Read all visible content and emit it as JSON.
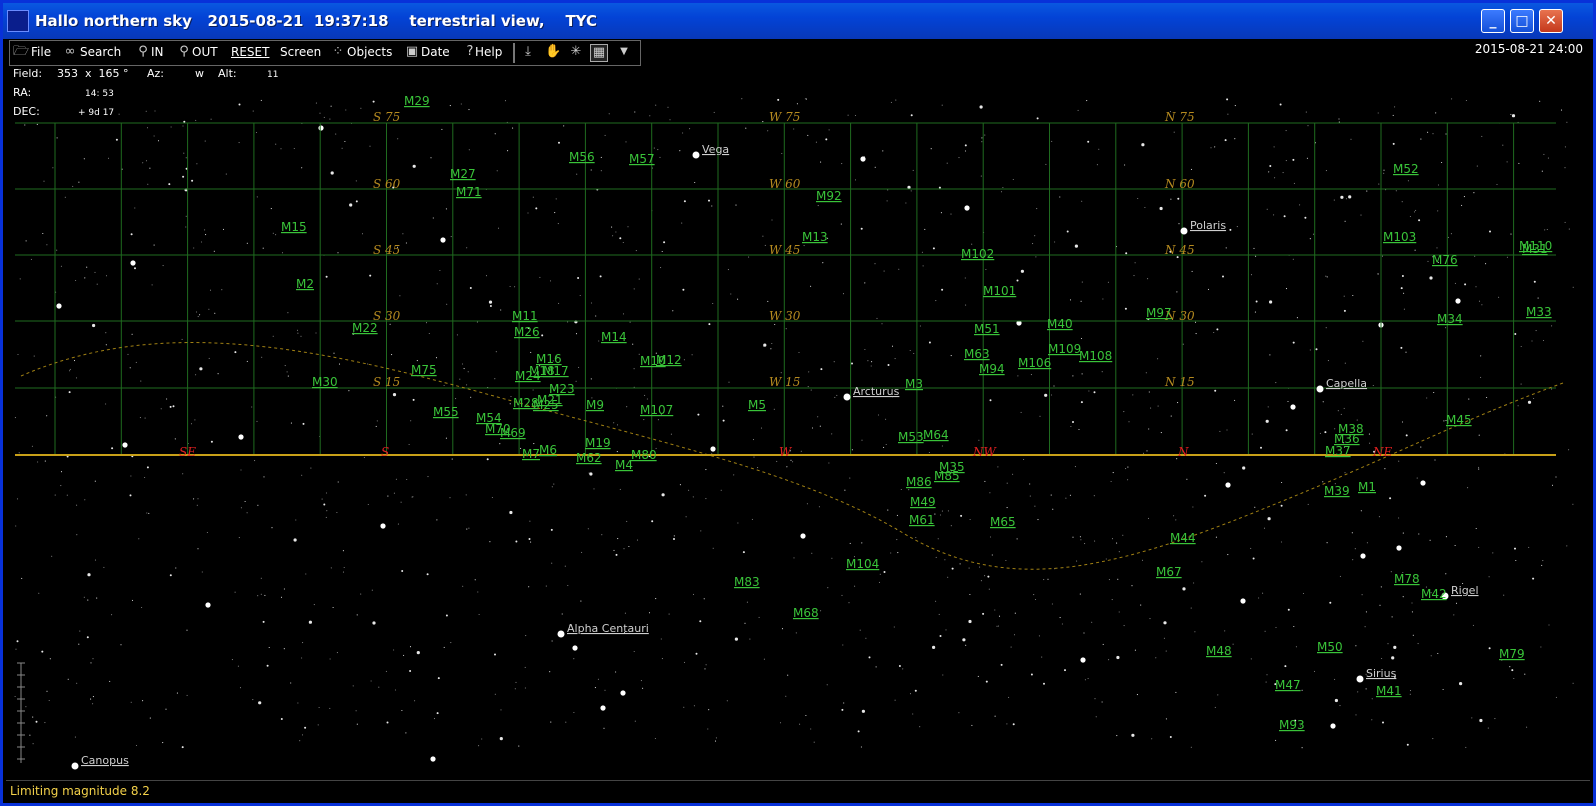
{
  "window": {
    "title": "Hallo northern sky   2015-08-21  19:37:18    terrestrial view,    TYC",
    "min_label": "_",
    "max_label": "□",
    "close_label": "✕"
  },
  "toolbar": {
    "file": "File",
    "search": "Search",
    "zoom_in": "IN",
    "zoom_out": "OUT",
    "reset": "RESET",
    "screen": "Screen",
    "objects": "Objects",
    "date": "Date",
    "help": "Help",
    "icons": [
      "file-icon",
      "binoculars-icon",
      "zoom-in-icon",
      "zoom-out-icon",
      "objects-icon",
      "calendar-icon",
      "help-icon",
      "download-icon",
      "hand-icon",
      "constellation-icon",
      "grid-icon",
      "dropdown-icon"
    ]
  },
  "datetime": "2015-08-21   24:00",
  "info": {
    "field_label": "Field:",
    "field_value": "353  x  165 °",
    "az_label": "Az:",
    "az_value": "w",
    "alt_label": "Alt:",
    "alt_value": "11",
    "ra_label": "RA:",
    "ra_value": "14: 53",
    "dec_label": "DEC:",
    "dec_value": "+ 9d 17"
  },
  "status": "Limiting magnitude 8.2",
  "colors": {
    "background": "#000000",
    "grid": "#1f6b1f",
    "horizon": "#c8a018",
    "messier": "#39c339",
    "grid_label": "#b58a1f",
    "direction": "#e02020",
    "title_bar": "#0a58e0",
    "status_text": "#f4d24a"
  },
  "sky": {
    "grid_labels": [
      {
        "text": "S 75"
      },
      {
        "text": "W 75"
      },
      {
        "text": "N 75"
      },
      {
        "text": "S 60"
      },
      {
        "text": "W 60"
      },
      {
        "text": "N 60"
      },
      {
        "text": "S 45"
      },
      {
        "text": "W 45"
      },
      {
        "text": "N 45"
      },
      {
        "text": "S 30"
      },
      {
        "text": "W 30"
      },
      {
        "text": "N 30"
      },
      {
        "text": "S 15"
      },
      {
        "text": "W 15"
      },
      {
        "text": "N 15"
      }
    ],
    "horizon_directions": [
      "SE",
      "S",
      "W",
      "NW",
      "N",
      "NE"
    ],
    "messier": [
      "M29",
      "M56",
      "M57",
      "M27",
      "M71",
      "M92",
      "M52",
      "M15",
      "M13",
      "M103",
      "M102",
      "M2",
      "M101",
      "M76",
      "M11",
      "M26",
      "M14",
      "M51",
      "M40",
      "M22",
      "M16",
      "M10",
      "M12",
      "M109",
      "M108",
      "M97",
      "M34",
      "M75",
      "M18",
      "M17",
      "M63",
      "M94",
      "M106",
      "M30",
      "M24",
      "M23",
      "M3",
      "M107",
      "M5",
      "M9",
      "M21",
      "M28",
      "M25",
      "M55",
      "M54",
      "M53",
      "M64",
      "M38",
      "M36",
      "M45",
      "M70",
      "M69",
      "M6",
      "M7",
      "M19",
      "M62",
      "M80",
      "M4",
      "M37",
      "M35",
      "M1",
      "M39",
      "M85",
      "M49",
      "M61",
      "M86",
      "M65",
      "M104",
      "M44",
      "M67",
      "M83",
      "M68",
      "M78",
      "M42",
      "M48",
      "M50",
      "M79",
      "M47",
      "M41",
      "M93",
      "M110",
      "M31",
      "M33"
    ],
    "stars": [
      "Vega",
      "Polaris",
      "Arcturus",
      "Capella",
      "Rigel",
      "Sirius",
      "Alpha Centauri",
      "Canopus"
    ]
  }
}
